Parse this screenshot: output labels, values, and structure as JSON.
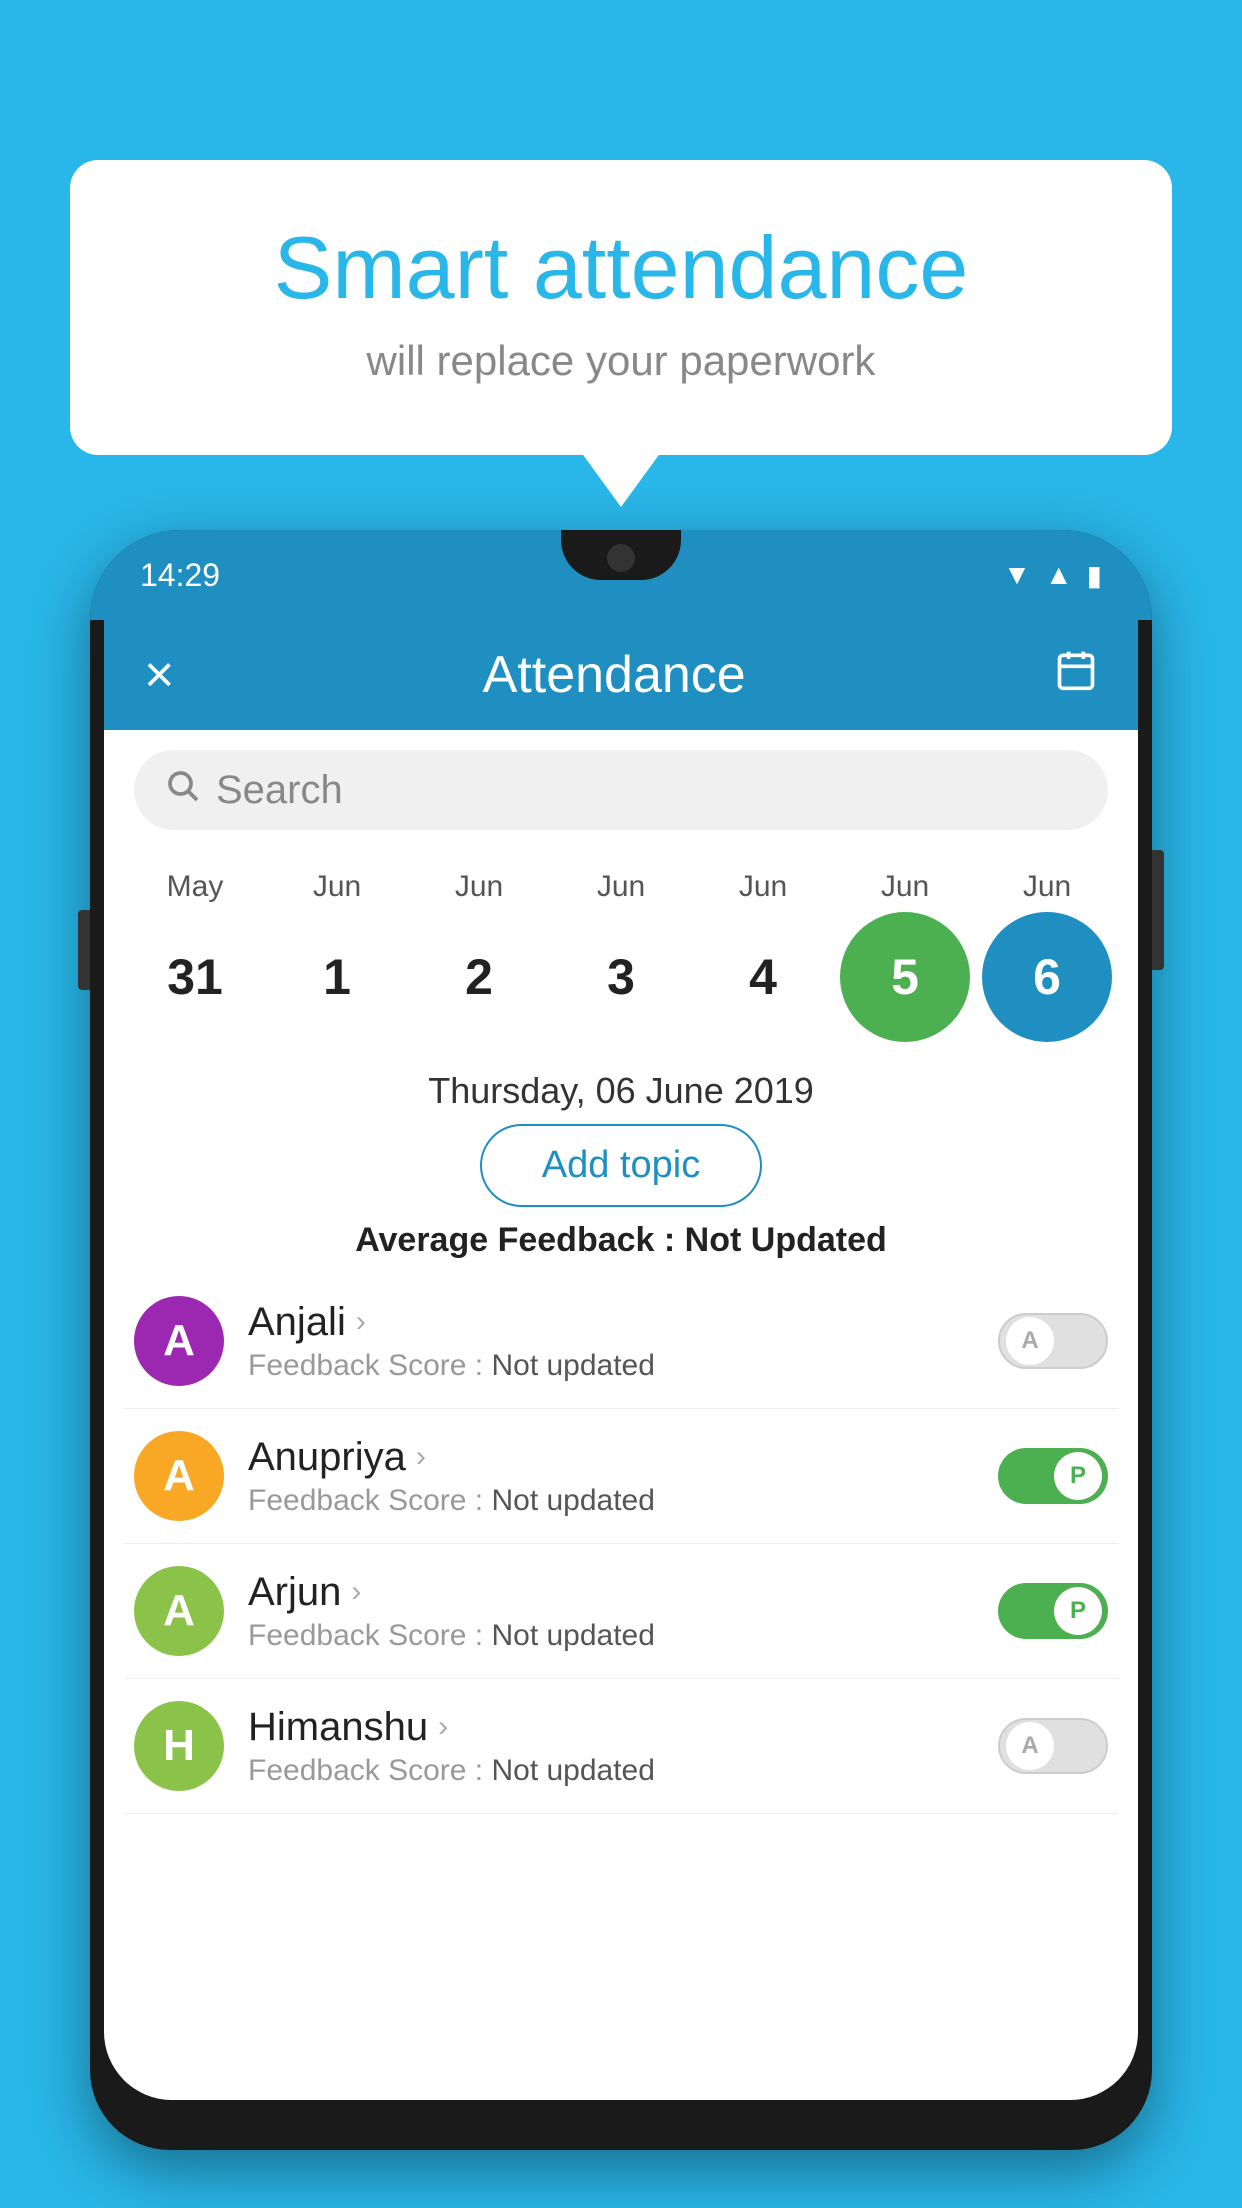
{
  "background_color": "#29b6e8",
  "speech_bubble": {
    "title": "Smart attendance",
    "subtitle": "will replace your paperwork"
  },
  "status_bar": {
    "time": "14:29"
  },
  "header": {
    "title": "Attendance",
    "close_label": "×",
    "calendar_icon": "calendar"
  },
  "search": {
    "placeholder": "Search"
  },
  "calendar": {
    "months": [
      "May",
      "Jun",
      "Jun",
      "Jun",
      "Jun",
      "Jun",
      "Jun"
    ],
    "dates": [
      "31",
      "1",
      "2",
      "3",
      "4",
      "5",
      "6"
    ],
    "today_index": 5,
    "selected_index": 6
  },
  "selected_date": "Thursday, 06 June 2019",
  "add_topic_label": "Add topic",
  "avg_feedback": {
    "label": "Average Feedback : ",
    "value": "Not Updated"
  },
  "students": [
    {
      "name": "Anjali",
      "avatar_letter": "A",
      "avatar_color": "#9c27b0",
      "feedback_label": "Feedback Score : ",
      "feedback_value": "Not updated",
      "attendance": "absent",
      "toggle_letter": "A"
    },
    {
      "name": "Anupriya",
      "avatar_letter": "A",
      "avatar_color": "#f9a825",
      "feedback_label": "Feedback Score : ",
      "feedback_value": "Not updated",
      "attendance": "present",
      "toggle_letter": "P"
    },
    {
      "name": "Arjun",
      "avatar_letter": "A",
      "avatar_color": "#8bc34a",
      "feedback_label": "Feedback Score : ",
      "feedback_value": "Not updated",
      "attendance": "present",
      "toggle_letter": "P"
    },
    {
      "name": "Himanshu",
      "avatar_letter": "H",
      "avatar_color": "#8bc34a",
      "feedback_label": "Feedback Score : ",
      "feedback_value": "Not updated",
      "attendance": "absent",
      "toggle_letter": "A"
    }
  ]
}
